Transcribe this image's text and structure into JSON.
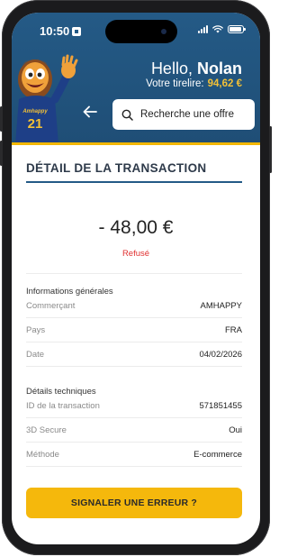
{
  "status_bar": {
    "time": "10:50"
  },
  "header": {
    "greeting_prefix": "Hello,",
    "user_name": "Nolan",
    "savings_label": "Votre tirelire:",
    "savings_amount": "94,62 €",
    "mascot_shirt_text": "Amhappy",
    "mascot_shirt_number": "21",
    "search_placeholder": "Recherche une offre"
  },
  "page": {
    "title": "DÉTAIL DE LA TRANSACTION",
    "amount": "- 48,00 €",
    "status": "Refusé"
  },
  "general_info": {
    "section_title": "Informations générales",
    "rows": [
      {
        "label": "Commerçant",
        "value": "AMHAPPY"
      },
      {
        "label": "Pays",
        "value": "FRA"
      },
      {
        "label": "Date",
        "value": "04/02/2026"
      }
    ]
  },
  "technical_details": {
    "section_title": "Détails techniques",
    "rows": [
      {
        "label": "ID de la transaction",
        "value": "571851455"
      },
      {
        "label": "3D Secure",
        "value": "Oui"
      },
      {
        "label": "Méthode",
        "value": "E-commerce"
      }
    ]
  },
  "report_button_label": "SIGNALER UNE ERREUR ?",
  "colors": {
    "header_blue": "#245a86",
    "accent_yellow": "#f5b80c",
    "refused_red": "#e03131"
  }
}
